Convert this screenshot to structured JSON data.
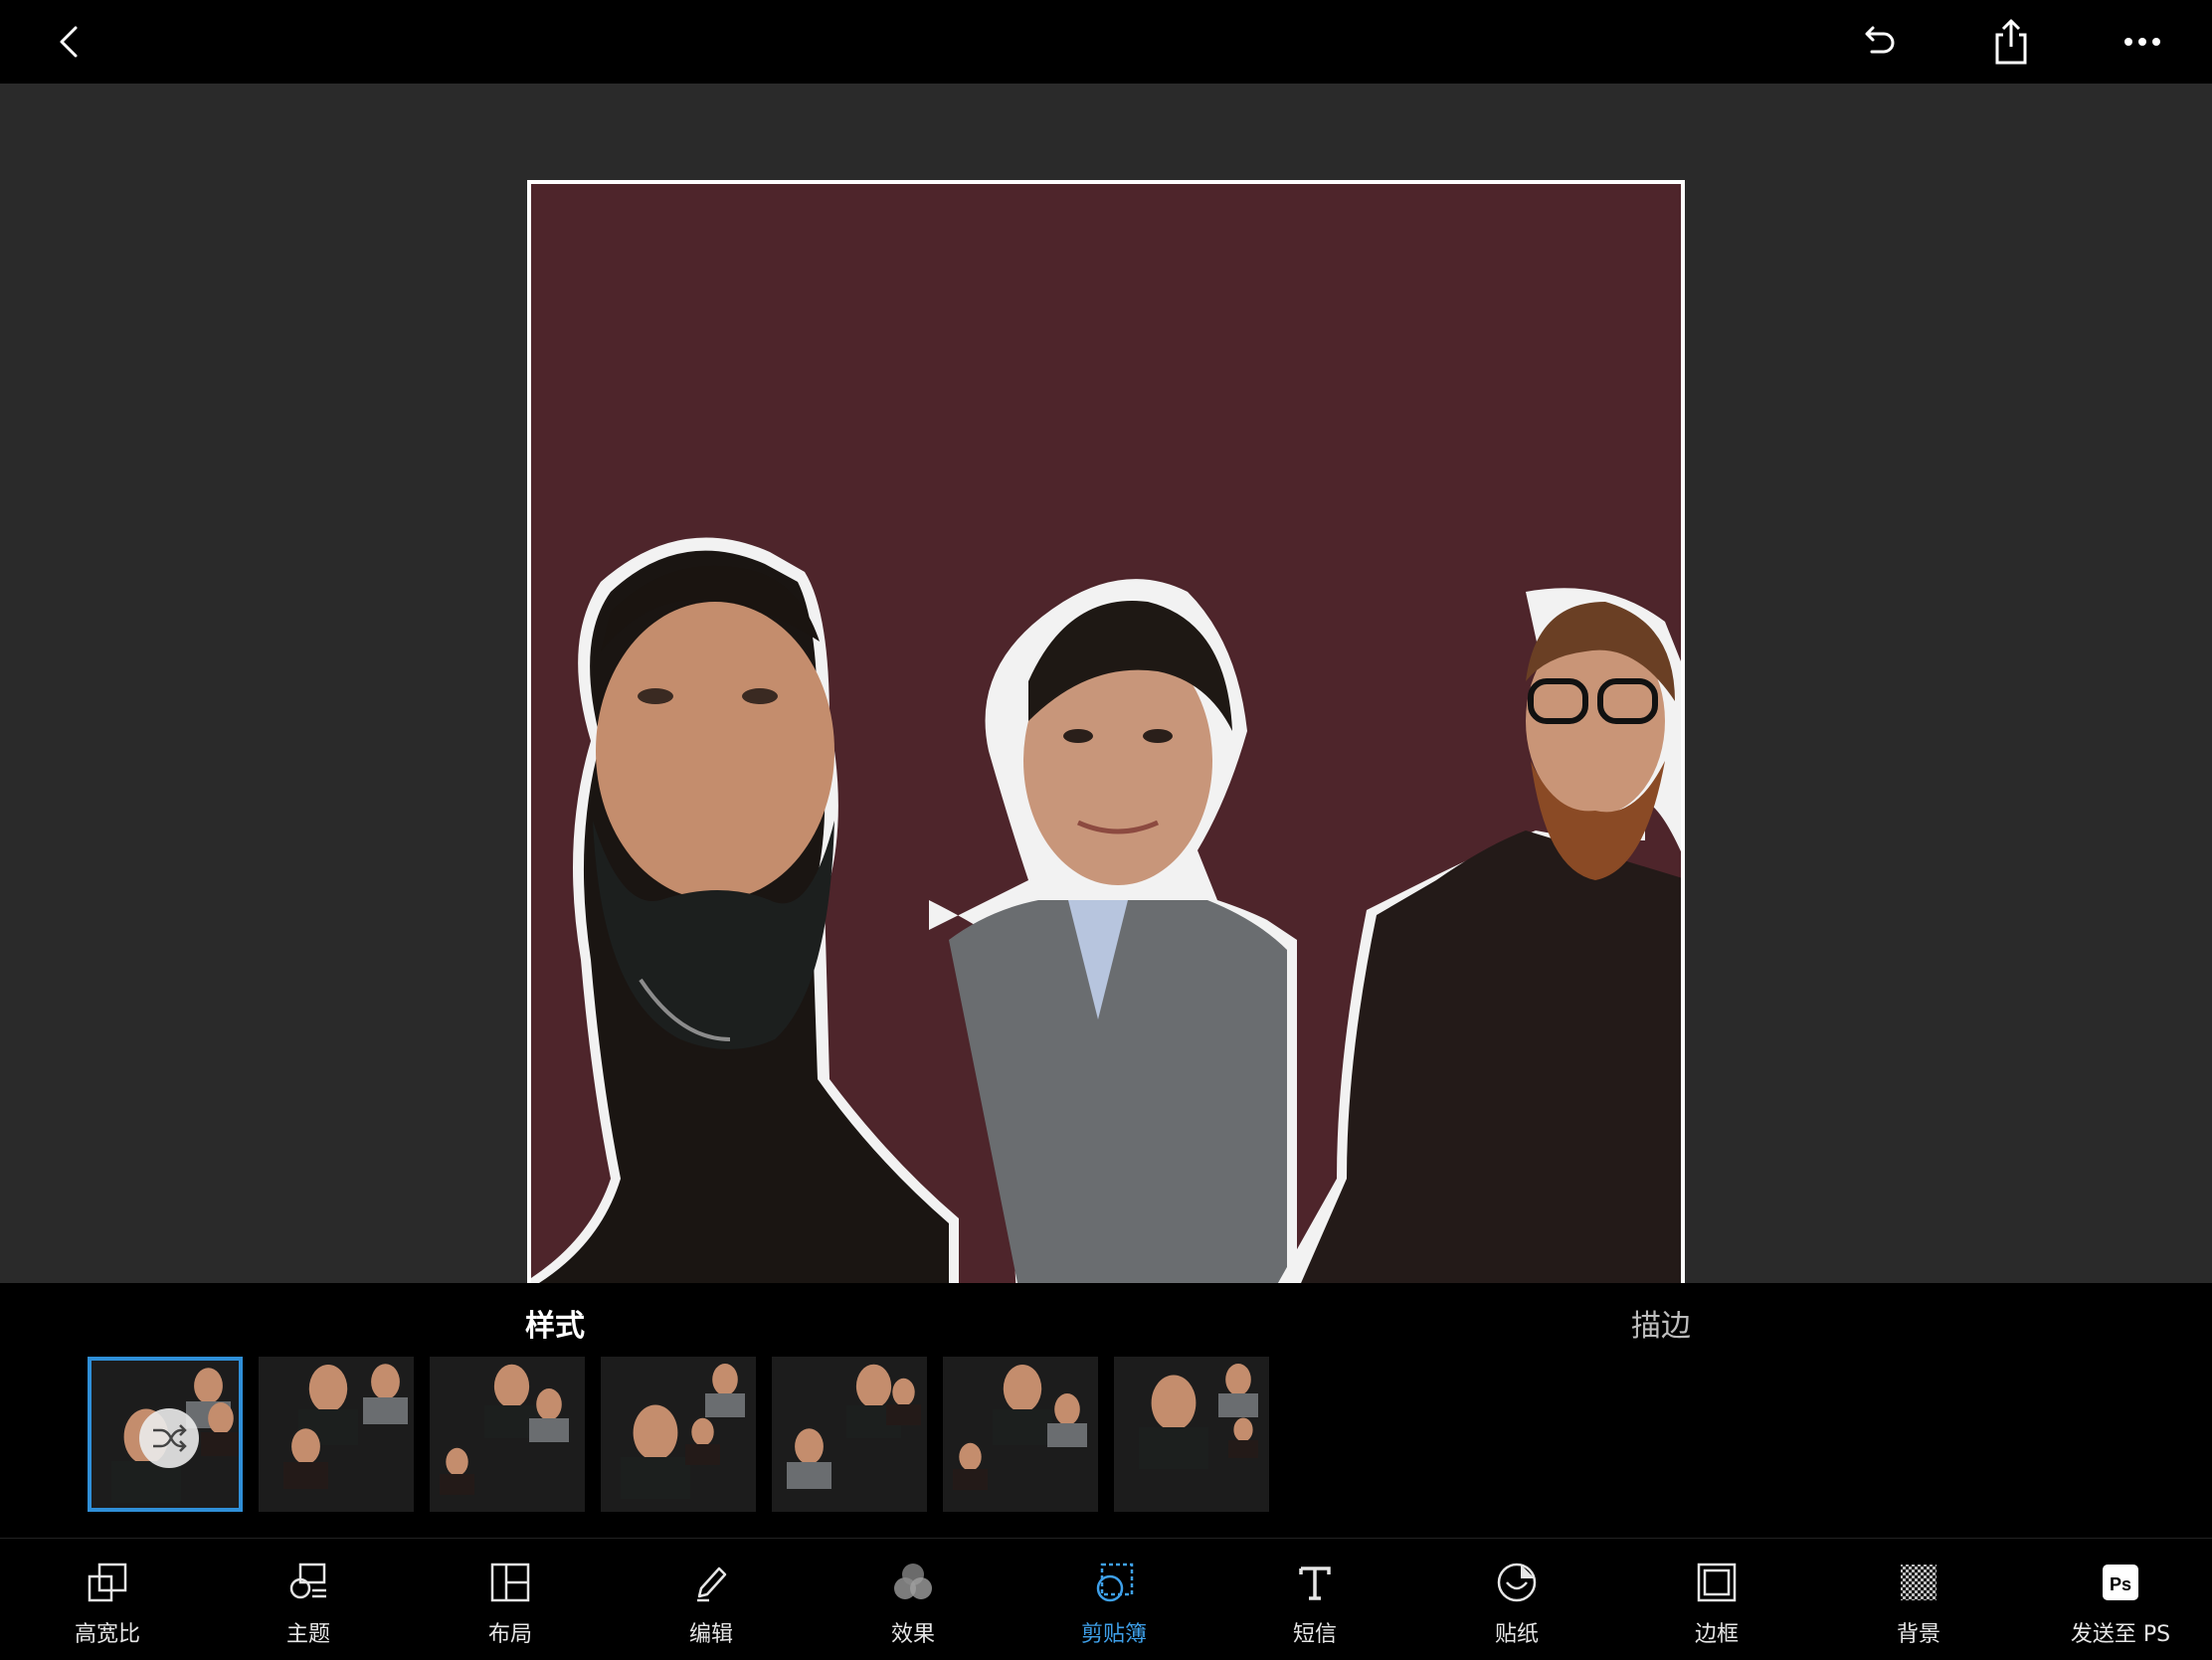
{
  "topbar": {
    "back_icon": "chevron-left-icon",
    "undo_icon": "undo-icon",
    "share_icon": "share-icon",
    "more_icon": "more-horizontal-icon"
  },
  "collage": {
    "background_color": "#4e252b",
    "border_color": "#ffffff"
  },
  "style_panel": {
    "tabs": [
      {
        "label": "样式",
        "active": true
      },
      {
        "label": "描边",
        "active": false
      }
    ],
    "thumbnails_count": 7,
    "selected_index": 0,
    "shuffle_icon": "shuffle-icon"
  },
  "toolbar": {
    "accent_color": "#3ea0ea",
    "items": [
      {
        "label": "高宽比",
        "icon": "aspect-ratio-icon"
      },
      {
        "label": "主题",
        "icon": "theme-icon"
      },
      {
        "label": "布局",
        "icon": "layout-icon"
      },
      {
        "label": "编辑",
        "icon": "edit-pencil-icon"
      },
      {
        "label": "效果",
        "icon": "effects-icon"
      },
      {
        "label": "剪贴簿",
        "icon": "scrapbook-icon",
        "active": true
      },
      {
        "label": "短信",
        "icon": "text-icon"
      },
      {
        "label": "贴纸",
        "icon": "sticker-icon"
      },
      {
        "label": "边框",
        "icon": "border-icon"
      },
      {
        "label": "背景",
        "icon": "background-icon"
      },
      {
        "label": "发送至 PS",
        "icon": "photoshop-icon"
      }
    ]
  }
}
